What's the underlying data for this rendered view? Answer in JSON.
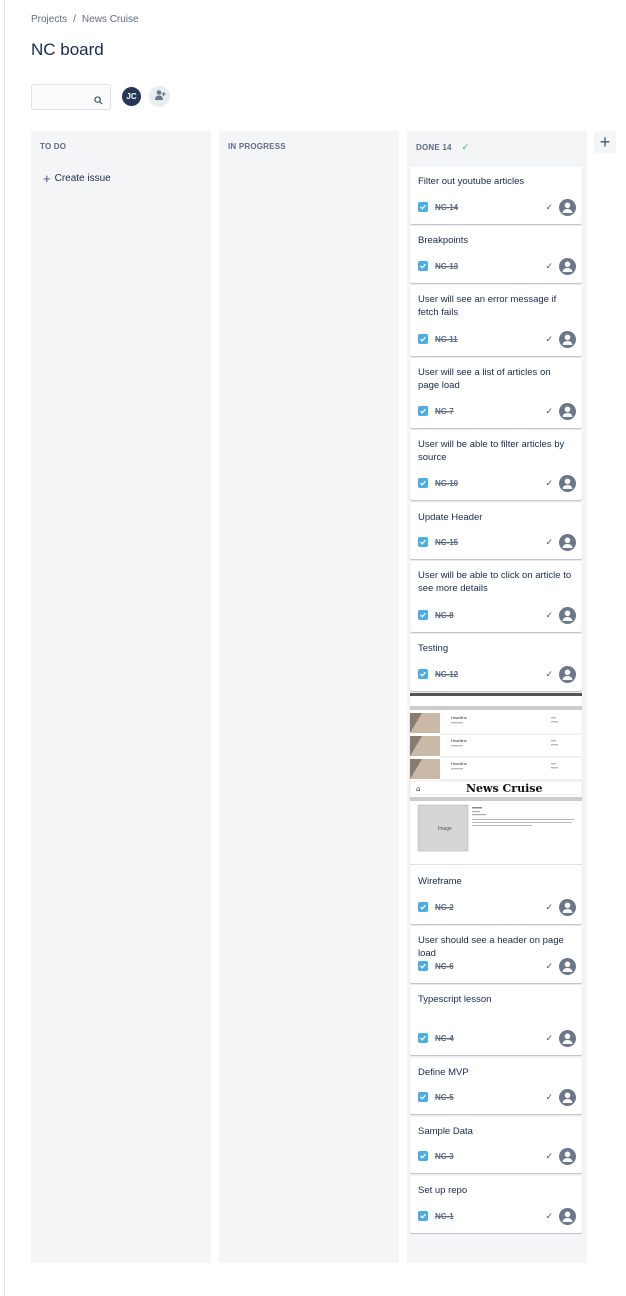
{
  "breadcrumb": {
    "projects": "Projects",
    "separator": "/",
    "project": "News Cruise"
  },
  "page_title": "NC board",
  "search": {
    "placeholder": "",
    "value": ""
  },
  "avatar": {
    "initials": "JC"
  },
  "columns": {
    "todo": {
      "title": "TO DO",
      "create_label": "Create issue"
    },
    "in_progress": {
      "title": "IN PROGRESS"
    },
    "done": {
      "title": "DONE 14"
    }
  },
  "done_cards": [
    {
      "title": "Filter out youtube articles",
      "key": "NC-14"
    },
    {
      "title": "Breakpoints",
      "key": "NC-13"
    },
    {
      "title": "User will see an error message if fetch fails",
      "key": "NC-11"
    },
    {
      "title": "User will see a list of articles on page load",
      "key": "NC-7"
    },
    {
      "title": "User will be able to filter articles by source",
      "key": "NC-10"
    },
    {
      "title": "Update Header",
      "key": "NC-15"
    },
    {
      "title": "User will be able to click on article to see more details",
      "key": "NC-8"
    },
    {
      "title": "Testing",
      "key": "NC-12"
    },
    {
      "title": "Wireframe",
      "key": "NC-2"
    },
    {
      "title": "User should see a header on page load",
      "key": "NC-6"
    },
    {
      "title": "Typescript lesson",
      "key": "NC-4"
    },
    {
      "title": "Define MVP",
      "key": "NC-5"
    },
    {
      "title": "Sample Data",
      "key": "NC-3"
    },
    {
      "title": "Set up repo",
      "key": "NC-1"
    }
  ],
  "wireframe_preview": {
    "logo_text": "News Cruise",
    "list_items": [
      "Headline",
      "Headline",
      "Headline"
    ],
    "image_label": "Image"
  },
  "colors": {
    "accent": "#4bade8",
    "done_check": "#36b37e",
    "column_bg": "#f4f5f7",
    "avatar_bg": "#253858"
  },
  "icons": {
    "search": "search-icon",
    "add_people": "add-people-icon",
    "story_done": "checkbox-icon",
    "done": "check-icon",
    "assignee": "person-icon",
    "add_column": "plus-icon"
  }
}
